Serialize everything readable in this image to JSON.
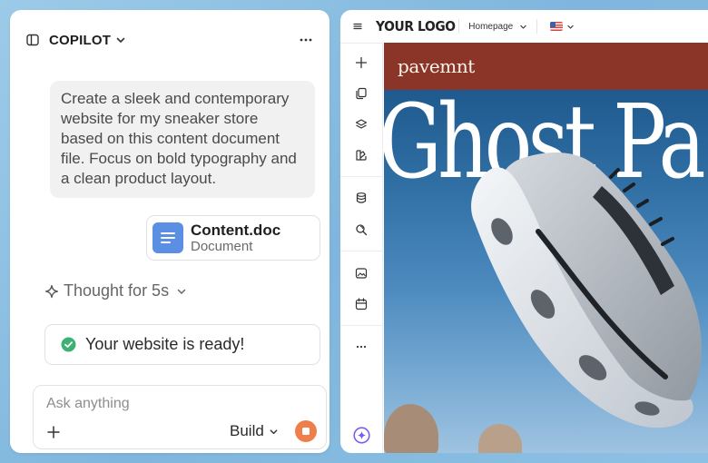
{
  "copilot": {
    "title": "COPILOT",
    "user_message": "Create a sleek and contemporary website for my sneaker store based on this content document file. Focus on bold typography and a clean product layout.",
    "attachment": {
      "name": "Content.doc",
      "type": "Document"
    },
    "thought_label": "Thought for 5s",
    "status_message": "Your website is ready!",
    "input": {
      "placeholder": "Ask anything",
      "value": ""
    },
    "mode_label": "Build",
    "colors": {
      "accent": "#f07e4b",
      "success": "#3bb273",
      "doc": "#5b8fe4"
    }
  },
  "builder": {
    "logo": "YOUR LOGO",
    "page_selector": "Homepage",
    "locale_icon": "us-flag-icon",
    "tools": [
      "plus-icon",
      "pages-icon",
      "layers-icon",
      "palette-icon",
      "database-icon",
      "search-icon",
      "image-icon",
      "calendar-icon",
      "more-icon",
      "ai-sparkle-icon"
    ],
    "preview": {
      "brand": "pavemnt",
      "headline": "Ghost Pa",
      "colors": {
        "brand_bar": "#8b3528",
        "sky_top": "#1f5a8e",
        "sky_bottom": "#9fc3e0"
      }
    }
  }
}
